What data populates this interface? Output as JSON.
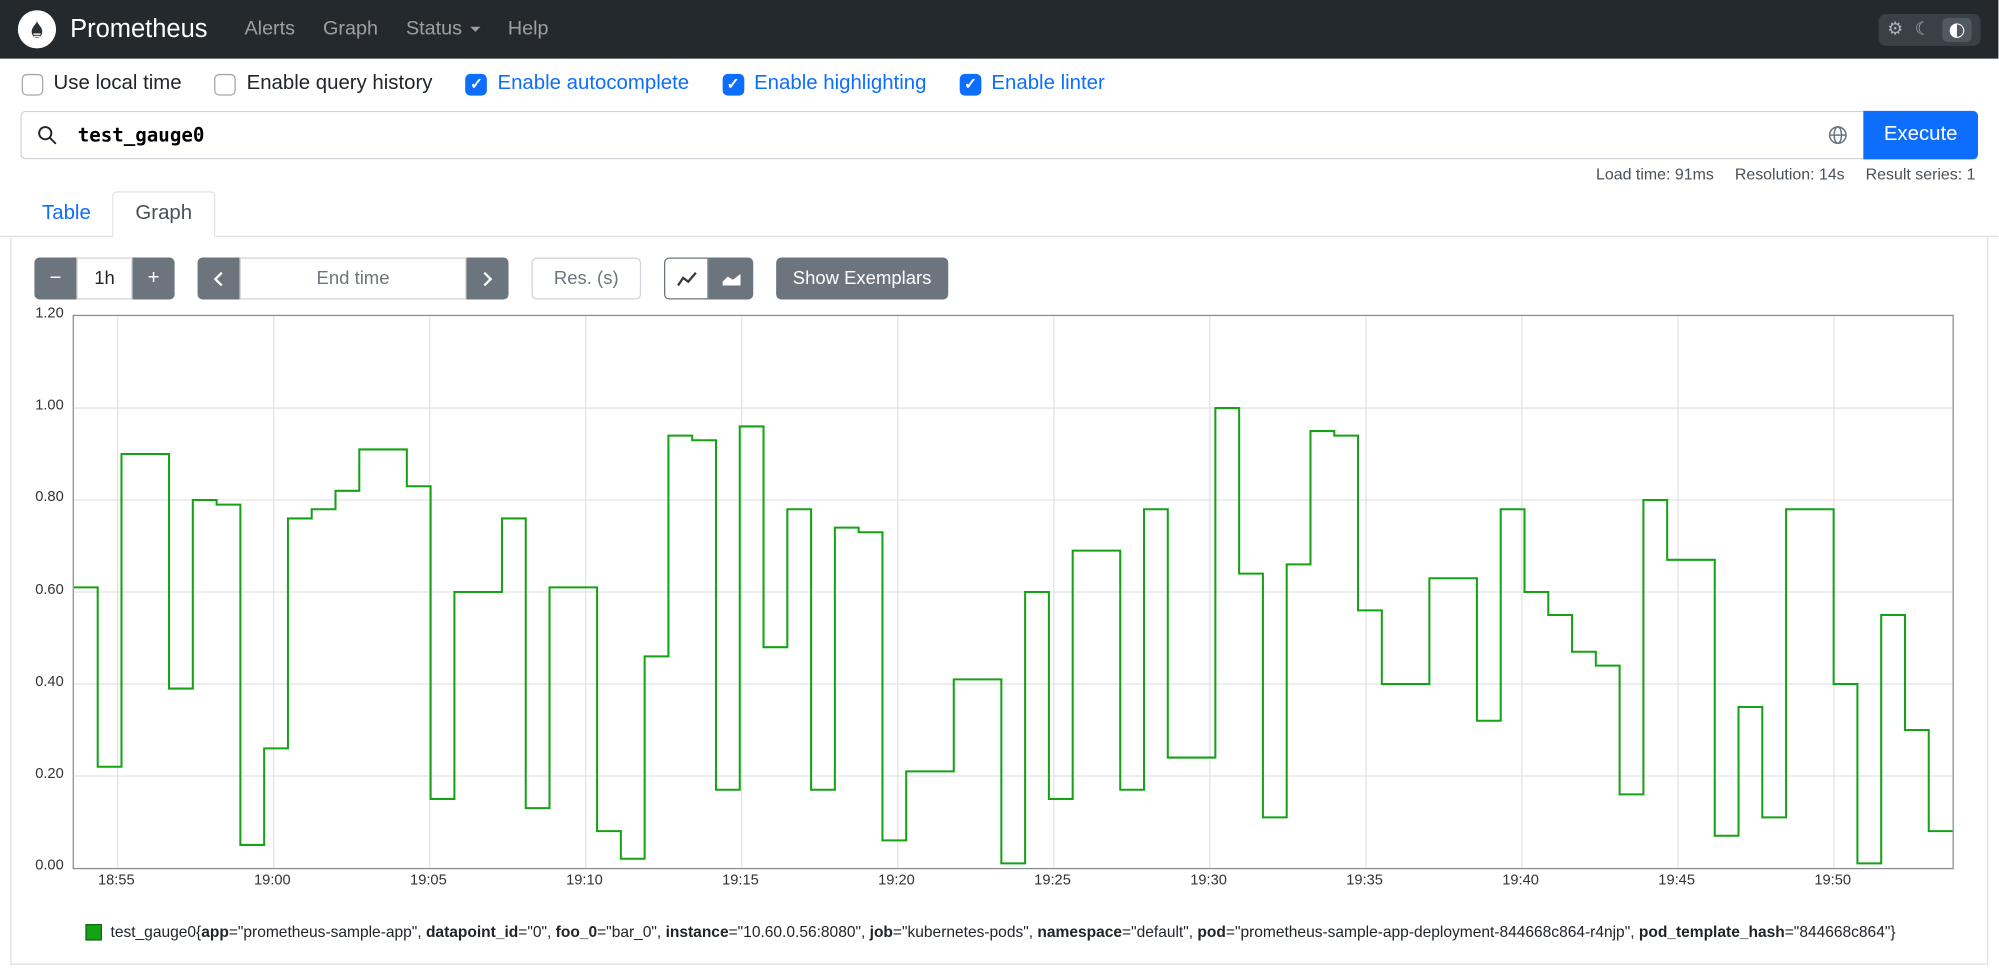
{
  "navbar": {
    "brand": "Prometheus",
    "items": [
      {
        "label": "Alerts"
      },
      {
        "label": "Graph"
      },
      {
        "label": "Status",
        "has_dropdown": true
      },
      {
        "label": "Help"
      }
    ]
  },
  "options": {
    "items": [
      {
        "label": "Use local time",
        "checked": false
      },
      {
        "label": "Enable query history",
        "checked": false
      },
      {
        "label": "Enable autocomplete",
        "checked": true
      },
      {
        "label": "Enable highlighting",
        "checked": true
      },
      {
        "label": "Enable linter",
        "checked": true
      }
    ]
  },
  "query": {
    "value": "test_gauge0",
    "execute_label": "Execute"
  },
  "stats": {
    "load_time": "Load time: 91ms",
    "resolution": "Resolution: 14s",
    "result_series": "Result series: 1"
  },
  "tabs": [
    {
      "label": "Table",
      "active": false
    },
    {
      "label": "Graph",
      "active": true
    }
  ],
  "toolbar": {
    "minus_label": "−",
    "duration_value": "1h",
    "plus_label": "+",
    "end_time_placeholder": "End time",
    "res_placeholder": "Res. (s)",
    "show_exemplars_label": "Show Exemplars"
  },
  "chart_data": {
    "type": "line",
    "step": true,
    "grid": true,
    "legend_position": "bottom",
    "ylim": [
      0,
      1.2
    ],
    "y_ticks": [
      "0.00",
      "0.20",
      "0.40",
      "0.60",
      "0.80",
      "1.00",
      "1.20"
    ],
    "x_axis": {
      "tick_labels": [
        "18:55",
        "19:00",
        "19:05",
        "19:10",
        "19:15",
        "19:20",
        "19:25",
        "19:30",
        "19:35",
        "19:40",
        "19:45",
        "19:50"
      ],
      "start_offset_min": 1.4,
      "tick_interval_min": 5,
      "total_min": 60.2
    },
    "series": [
      {
        "name": "test_gauge0",
        "color": "#15a315",
        "values": [
          0.61,
          0.22,
          0.9,
          0.9,
          0.39,
          0.8,
          0.79,
          0.05,
          0.26,
          0.76,
          0.78,
          0.82,
          0.91,
          0.91,
          0.83,
          0.15,
          0.6,
          0.6,
          0.76,
          0.13,
          0.61,
          0.61,
          0.08,
          0.02,
          0.46,
          0.94,
          0.93,
          0.17,
          0.96,
          0.48,
          0.78,
          0.17,
          0.74,
          0.73,
          0.06,
          0.21,
          0.21,
          0.41,
          0.41,
          0.01,
          0.6,
          0.15,
          0.69,
          0.69,
          0.17,
          0.78,
          0.24,
          0.24,
          1.0,
          0.64,
          0.11,
          0.66,
          0.95,
          0.94,
          0.56,
          0.4,
          0.4,
          0.63,
          0.63,
          0.32,
          0.78,
          0.6,
          0.55,
          0.47,
          0.44,
          0.16,
          0.8,
          0.67,
          0.67,
          0.07,
          0.35,
          0.11,
          0.78,
          0.78,
          0.4,
          0.01,
          0.55,
          0.3,
          0.08
        ]
      }
    ]
  },
  "legend": {
    "metric": "test_gauge0",
    "labels": [
      {
        "key": "app",
        "value": "prometheus-sample-app"
      },
      {
        "key": "datapoint_id",
        "value": "0"
      },
      {
        "key": "foo_0",
        "value": "bar_0"
      },
      {
        "key": "instance",
        "value": "10.60.0.56:8080"
      },
      {
        "key": "job",
        "value": "kubernetes-pods"
      },
      {
        "key": "namespace",
        "value": "default"
      },
      {
        "key": "pod",
        "value": "prometheus-sample-app-deployment-844668c864-r4njp"
      },
      {
        "key": "pod_template_hash",
        "value": "844668c864"
      }
    ]
  }
}
